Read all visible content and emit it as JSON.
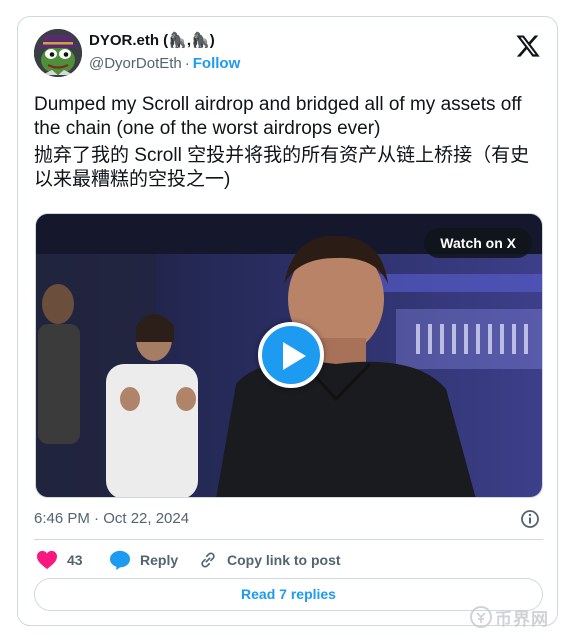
{
  "tweet": {
    "author": {
      "display_name": "DYOR.eth (🦍,🦍)",
      "handle": "@DyorDotEth",
      "separator": "·",
      "follow_label": "Follow",
      "avatar_icon": "pepe-frog-avatar"
    },
    "platform_icon": "x-logo-icon",
    "text_lines": [
      "Dumped my Scroll airdrop and bridged all of my assets off the chain (one of the worst airdrops ever)",
      "抛弃了我的 Scroll 空投并将我的所有资产从链上桥接（有史以来最糟糕的空投之一)"
    ],
    "media": {
      "type": "video",
      "watch_label": "Watch on X",
      "play_icon": "play-icon"
    },
    "timestamp": "6:46 PM · Oct 22, 2024",
    "actions": {
      "like_count": "43",
      "reply_label": "Reply",
      "copy_label": "Copy link to post"
    },
    "read_replies_label": "Read 7 replies"
  },
  "watermark": {
    "text": "币界网",
    "icon": "coin-logo-icon"
  },
  "colors": {
    "accent": "#1d9bf0",
    "like": "#f91880",
    "text_primary": "#0f1419",
    "text_secondary": "#536471",
    "border": "#cfd9de"
  }
}
